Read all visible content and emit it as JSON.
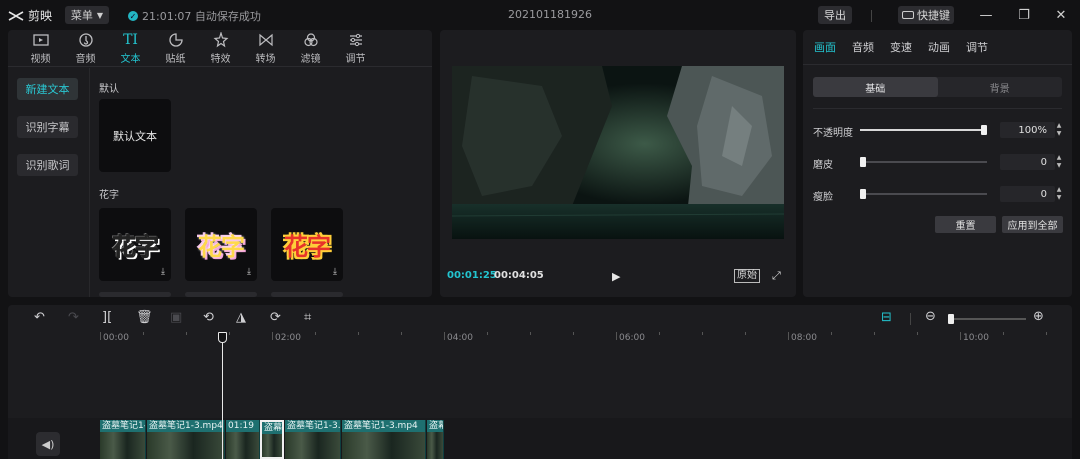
{
  "app": {
    "logo_text": "剪映",
    "menu_label": "菜单",
    "save_status": "21:01:07 自动保存成功",
    "project_name": "202101181926",
    "export_label": "导出",
    "shortcut_label": "快捷键"
  },
  "library": {
    "tabs": [
      {
        "label": "视频",
        "icon": "video-icon"
      },
      {
        "label": "音频",
        "icon": "audio-icon"
      },
      {
        "label": "文本",
        "icon": "text-icon"
      },
      {
        "label": "贴纸",
        "icon": "sticker-icon"
      },
      {
        "label": "特效",
        "icon": "effects-icon"
      },
      {
        "label": "转场",
        "icon": "transition-icon"
      },
      {
        "label": "滤镜",
        "icon": "filter-icon"
      },
      {
        "label": "调节",
        "icon": "adjust-icon"
      }
    ],
    "active_tab": "文本",
    "side_buttons": [
      "新建文本",
      "识别字幕",
      "识别歌词"
    ],
    "section_default": "默认",
    "default_card_label": "默认文本",
    "section_fancy": "花字",
    "fancy_cards": [
      "花字",
      "花字",
      "花字"
    ]
  },
  "preview": {
    "current_time": "00:01:25",
    "total_time": "00:04:05",
    "original_label": "原始"
  },
  "inspector": {
    "tabs": [
      "画面",
      "音频",
      "变速",
      "动画",
      "调节"
    ],
    "segments": [
      "基础",
      "背景"
    ],
    "sliders": [
      {
        "label": "不透明度",
        "value": "100%",
        "level": 1.0
      },
      {
        "label": "磨皮",
        "value": "0",
        "level": 0.0
      },
      {
        "label": "瘦脸",
        "value": "0",
        "level": 0.0
      }
    ],
    "reset_label": "重置",
    "apply_all_label": "应用到全部"
  },
  "timeline": {
    "ruler": [
      "00:00",
      "02:00",
      "04:00",
      "06:00",
      "08:00",
      "10:00"
    ],
    "clips": [
      "盗墓笔记1-",
      "盗墓笔记1-3.mp4",
      "01:19",
      "盗幕",
      "盗墓笔记1-3.",
      "盗墓笔记1-3.mp4",
      "盗幕"
    ]
  },
  "colors": {
    "accent": "#23c4cf",
    "panel": "#1c1c1f",
    "background": "#121214",
    "clip": "#1e6a6a"
  }
}
